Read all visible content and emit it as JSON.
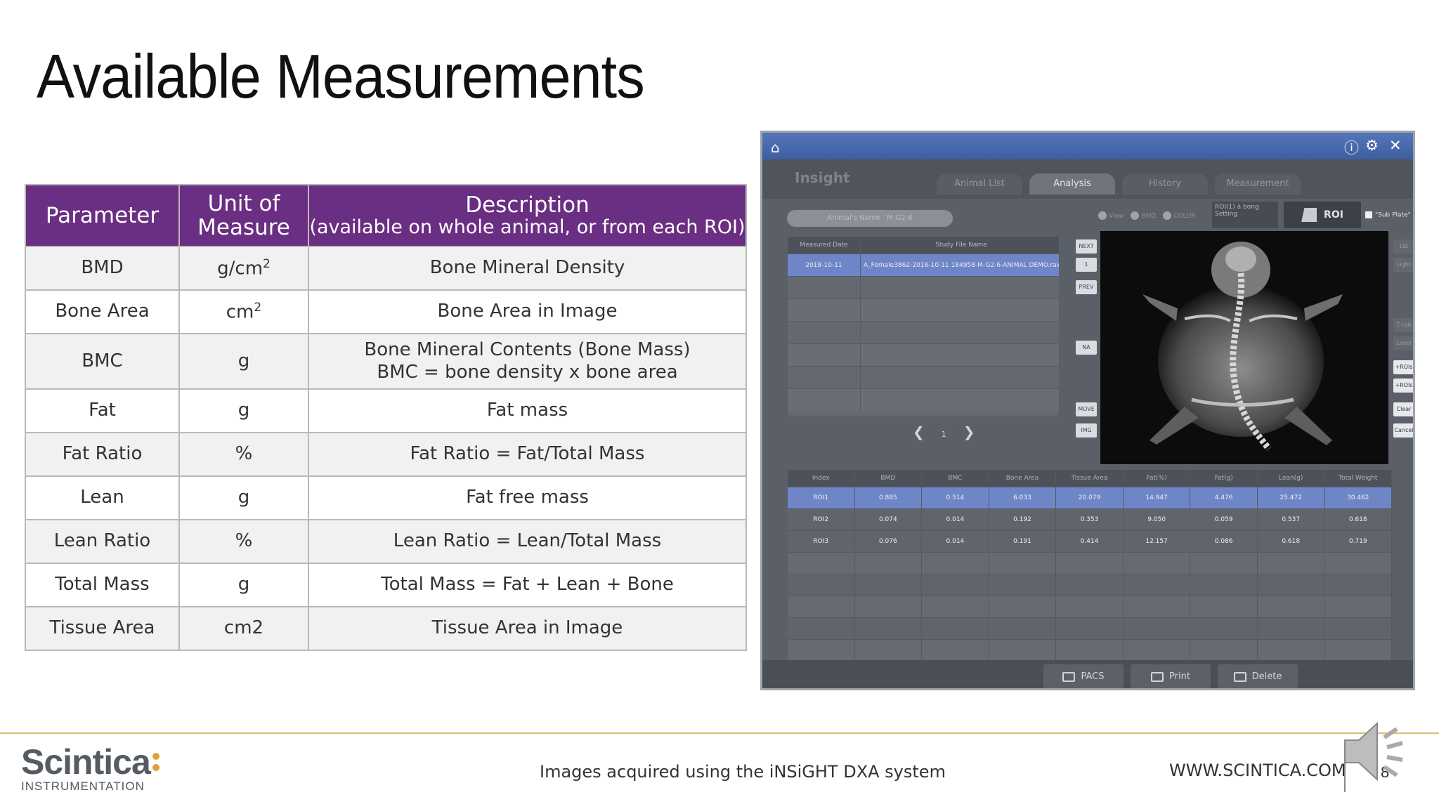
{
  "slide": {
    "title": "Available Measurements",
    "caption": "Images acquired using the iNSiGHT DXA system",
    "website": "WWW.SCINTICA.COM",
    "page_number": "8",
    "logo_name": "Scintica",
    "logo_tagline": "INSTRUMENTATION",
    "accent_color": "#6a2e82",
    "rule_color": "#e2b86a"
  },
  "table": {
    "headers": {
      "parameter": "Parameter",
      "unit_line1": "Unit of",
      "unit_line2": "Measure",
      "desc_line1": "Description",
      "desc_line2": "(available on whole animal, or from each ROI)"
    },
    "rows": [
      {
        "parameter": "BMD",
        "unit": "g/cm",
        "unit_sup": "2",
        "desc1": "Bone Mineral Density",
        "desc2": ""
      },
      {
        "parameter": "Bone Area",
        "unit": "cm",
        "unit_sup": "2",
        "desc1": "Bone Area in Image",
        "desc2": ""
      },
      {
        "parameter": "BMC",
        "unit": "g",
        "unit_sup": "",
        "desc1": "Bone Mineral Contents (Bone Mass)",
        "desc2": "BMC = bone density x bone area"
      },
      {
        "parameter": "Fat",
        "unit": "g",
        "unit_sup": "",
        "desc1": "Fat mass",
        "desc2": ""
      },
      {
        "parameter": "Fat Ratio",
        "unit": "%",
        "unit_sup": "",
        "desc1": "Fat Ratio = Fat/Total Mass",
        "desc2": ""
      },
      {
        "parameter": "Lean",
        "unit": "g",
        "unit_sup": "",
        "desc1": "Fat free mass",
        "desc2": ""
      },
      {
        "parameter": "Lean Ratio",
        "unit": "%",
        "unit_sup": "",
        "desc1": "Lean Ratio = Lean/Total Mass",
        "desc2": ""
      },
      {
        "parameter": "Total Mass",
        "unit": "g",
        "unit_sup": "",
        "desc1": "Total Mass = Fat + Lean + Bone",
        "desc2": ""
      },
      {
        "parameter": "Tissue Area",
        "unit": "cm2",
        "unit_sup": "",
        "desc1": "Tissue Area in Image",
        "desc2": ""
      }
    ]
  },
  "app": {
    "brand": "Insight",
    "tabs": [
      "Animal List",
      "Analysis",
      "History",
      "Measurement"
    ],
    "active_tab": "Analysis",
    "animal_name_label": "Animal's Name",
    "animal_name_value": "M-G2-6",
    "radio_options": [
      "View",
      "BMD",
      "COLOR"
    ],
    "roi_info_line1": "ROI(1) à bong",
    "roi_info_line2": "Setting",
    "roi_button": "ROI",
    "sub_plate": "\"Sub Plate\"",
    "study_headers": [
      "Measured Date",
      "Study File Name"
    ],
    "study_rows": [
      {
        "date": "2018-10-11",
        "file": "A_Female3862-2018-10-11 184958-M-G2-6-ANIMAL DEMO.raw"
      }
    ],
    "side_buttons": [
      "NEXT",
      "1",
      "PREV",
      "NA",
      "MOVE",
      "IMG"
    ],
    "pager_page": "1",
    "right_buttons": [
      "Lib",
      "Light",
      "T-Lab",
      "Level",
      "+ROIs",
      "+ROIs",
      "Clear",
      "Cancel"
    ],
    "result_headers": [
      "Index",
      "BMD",
      "BMC",
      "Bone Area",
      "Tissue Area",
      "Fat(%)",
      "Fat(g)",
      "Lean(g)",
      "Total Weight"
    ],
    "result_rows": [
      [
        "ROI1",
        "0.885",
        "0.514",
        "6.033",
        "20.079",
        "14.947",
        "4.476",
        "25.472",
        "30.462"
      ],
      [
        "ROI2",
        "0.074",
        "0.014",
        "0.192",
        "0.353",
        "9.050",
        "0.059",
        "0.537",
        "0.618"
      ],
      [
        "ROI3",
        "0.076",
        "0.014",
        "0.191",
        "0.414",
        "12.157",
        "0.086",
        "0.618",
        "0.719"
      ]
    ],
    "bottom_buttons": [
      "PACS",
      "Print",
      "Delete"
    ]
  }
}
